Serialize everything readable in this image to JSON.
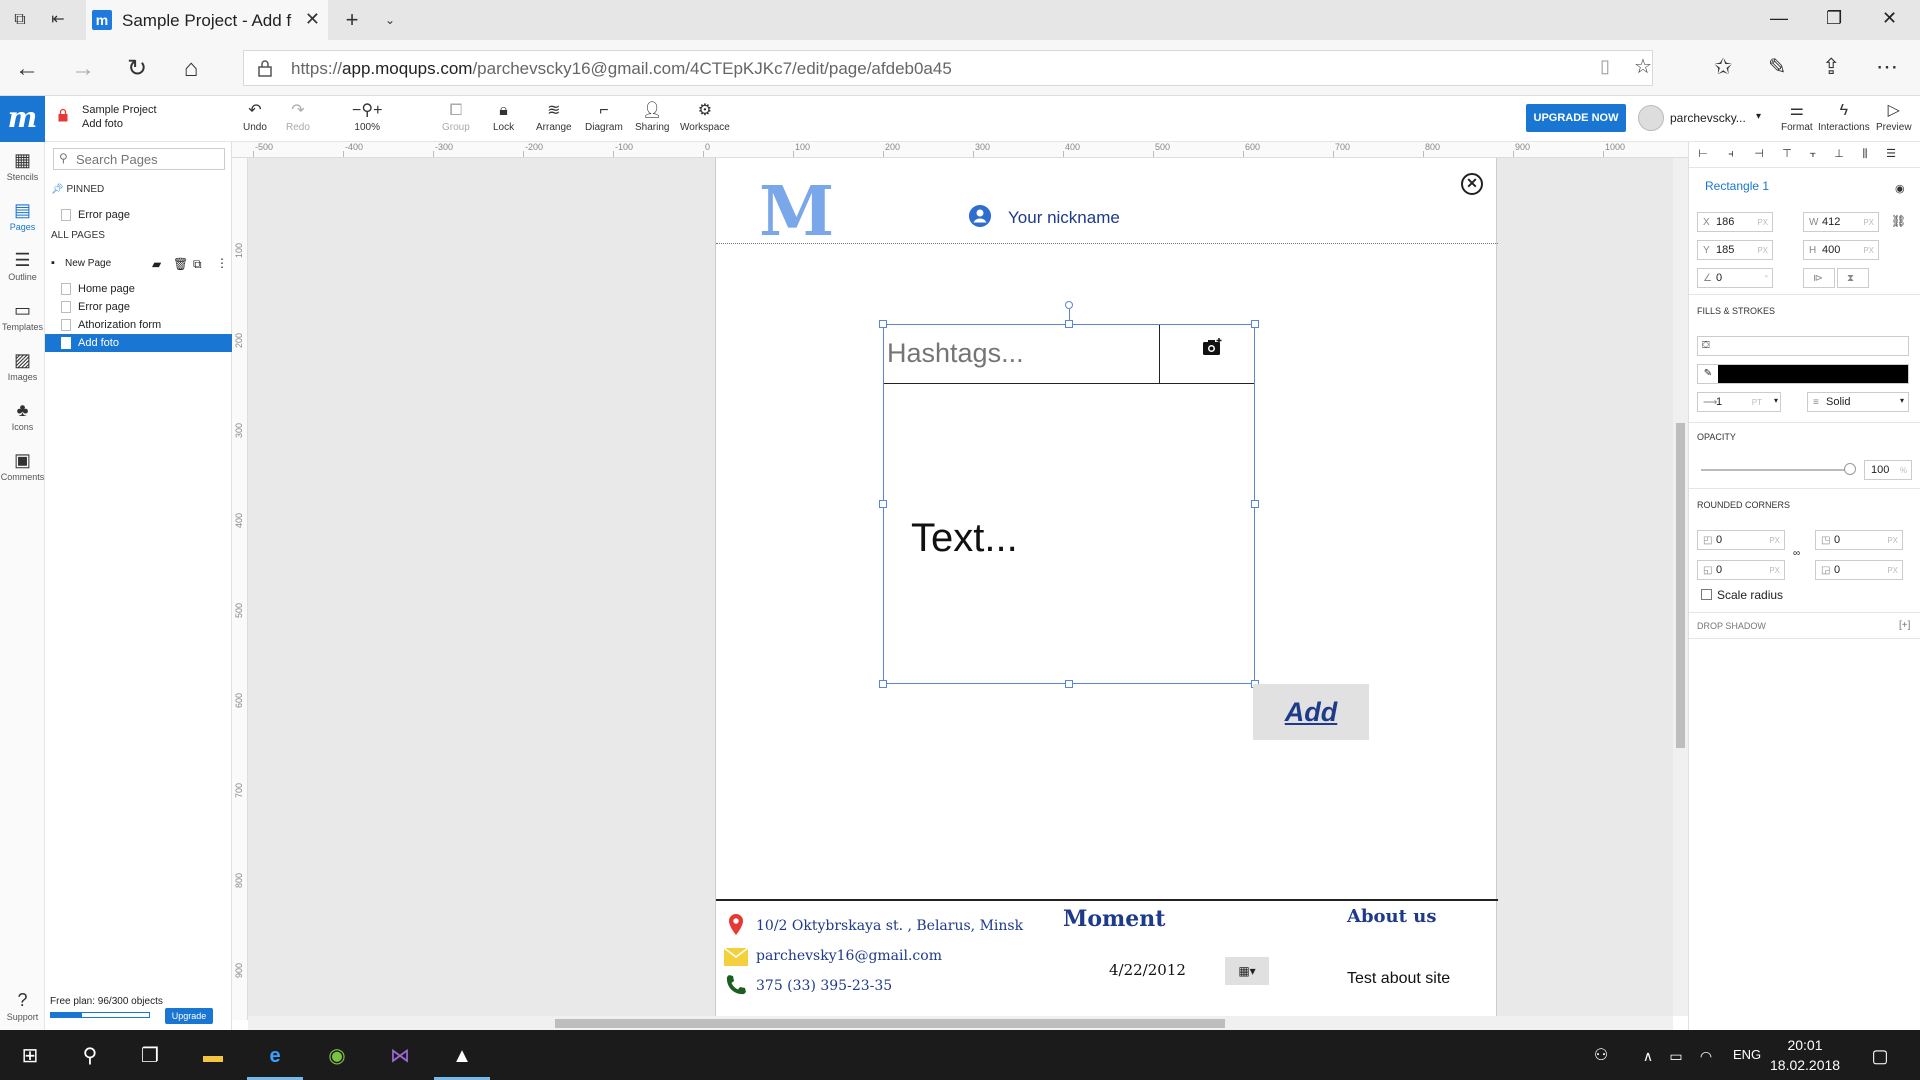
{
  "browser": {
    "tab_title": "Sample Project - Add fo",
    "url_prefix": "https://",
    "url_host": "app.moqups.com",
    "url_path": "/parchevscky16@gmail.com/4CTEpKJKc7/edit/page/afdeb0a45"
  },
  "app": {
    "logo_letter": "m",
    "project_title": "Sample Project",
    "project_page": "Add foto",
    "tools": {
      "undo": "Undo",
      "redo": "Redo",
      "zoom": "100%",
      "group": "Group",
      "lock": "Lock",
      "arrange": "Arrange",
      "diagram": "Diagram",
      "sharing": "Sharing",
      "workspace": "Workspace"
    },
    "upgrade_now": "UPGRADE NOW",
    "user_name": "parchevscky...",
    "right_tools": {
      "format": "Format",
      "interactions": "Interactions",
      "preview": "Preview"
    }
  },
  "left_strip": {
    "stencils": "Stencils",
    "pages": "Pages",
    "outline": "Outline",
    "templates": "Templates",
    "images": "Images",
    "icons": "Icons",
    "comments": "Comments",
    "support": "Support"
  },
  "pages_panel": {
    "search_placeholder": "Search Pages",
    "pinned_label": "PINNED",
    "pinned_pages": [
      "Error page"
    ],
    "all_pages_label": "ALL PAGES",
    "new_page": "New Page",
    "pages": [
      "Home page",
      "Error page",
      "Athorization form",
      "Add foto"
    ],
    "active_page": "Add foto",
    "plan_text": "Free plan: 96/300 objects",
    "plan_fraction": 0.32,
    "plan_upgrade": "Upgrade"
  },
  "rulers": {
    "top": [
      "-500",
      "-400",
      "-300",
      "-200",
      "-100",
      "0",
      "100",
      "200",
      "300",
      "400",
      "500",
      "600",
      "700",
      "800",
      "900",
      "1000"
    ],
    "left": [
      "100",
      "200",
      "300",
      "400",
      "500",
      "600",
      "700",
      "800",
      "900"
    ]
  },
  "mockup": {
    "logo": "M",
    "nickname": "Your nickname",
    "hashtags_placeholder": "Hashtags...",
    "text_placeholder": "Text...",
    "add_button": "Add",
    "footer": {
      "address": "10/2 Oktybrskaya st. , Belarus, Minsk",
      "email": "parchevsky16@gmail.com",
      "phone": "375 (33) 395-23-35",
      "moment": "Moment",
      "date": "4/22/2012",
      "about_us": "About us",
      "about_text": "Test about site"
    }
  },
  "properties": {
    "shape_name": "Rectangle 1",
    "x": "186",
    "y": "185",
    "w": "412",
    "h": "400",
    "angle": "0",
    "unit_px": "PX",
    "unit_pt": "PT",
    "unit_pct": "%",
    "fills_strokes": "FILLS & STROKES",
    "stroke_width": "1",
    "stroke_style": "Solid",
    "opacity_label": "OPACITY",
    "opacity_value": "100",
    "rounded_corners_label": "ROUNDED CORNERS",
    "corners": [
      "0",
      "0",
      "0",
      "0"
    ],
    "scale_radius": "Scale radius",
    "drop_shadow": "DROP SHADOW",
    "drop_shadow_add": "[+]"
  },
  "taskbar": {
    "lang": "ENG",
    "time": "20:01",
    "date": "18.02.2018"
  },
  "colors": {
    "accent": "#1976d2",
    "mockup_logo": "#7aa6ea",
    "mockup_text": "#1e3a8a"
  }
}
